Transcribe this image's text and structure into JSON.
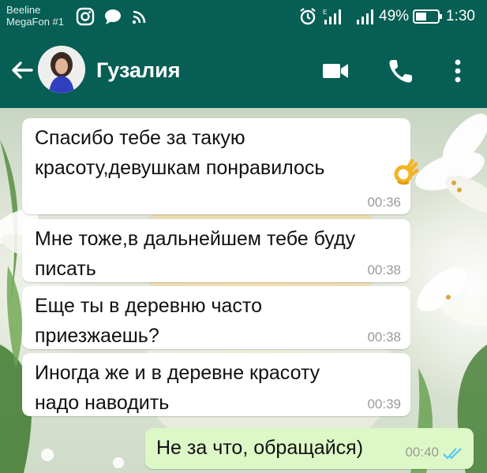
{
  "status_bar": {
    "carrier_1": "Beeline",
    "carrier_2": "MegaFon #1",
    "battery_percent": "49%",
    "time": "1:30",
    "icons": [
      "instagram-icon",
      "message-icon",
      "cast-icon",
      "alarm-icon",
      "signal-icon",
      "signal-icon",
      "battery-icon"
    ]
  },
  "toolbar": {
    "contact_name": "Гузалия",
    "icons": [
      "back-arrow-icon",
      "video-call-icon",
      "phone-icon",
      "more-vert-icon"
    ]
  },
  "messages": [
    {
      "direction": "incoming",
      "text": "Спасибо тебе за такую\nкрасоту,девушкам понравилось",
      "emoji": "ok-hand-emoji",
      "time": "00:36"
    },
    {
      "direction": "incoming",
      "text": "Мне тоже,в дальнейшем тебе буду\nписать",
      "time": "00:38"
    },
    {
      "direction": "incoming",
      "text": "Еще ты в деревню часто\nприезжаешь?",
      "time": "00:38"
    },
    {
      "direction": "incoming",
      "text": "Иногда же и в деревне красоту\nнадо наводить",
      "time": "00:39"
    },
    {
      "direction": "outgoing",
      "text": "Не за что, обращайся)",
      "time": "00:40",
      "read_status": "read"
    }
  ],
  "colors": {
    "header": "#075e54",
    "incoming_bubble": "#ffffff",
    "outgoing_bubble": "#dcf8c6",
    "read_ticks": "#4fc3f7",
    "timestamp": "#9a9a9a"
  }
}
